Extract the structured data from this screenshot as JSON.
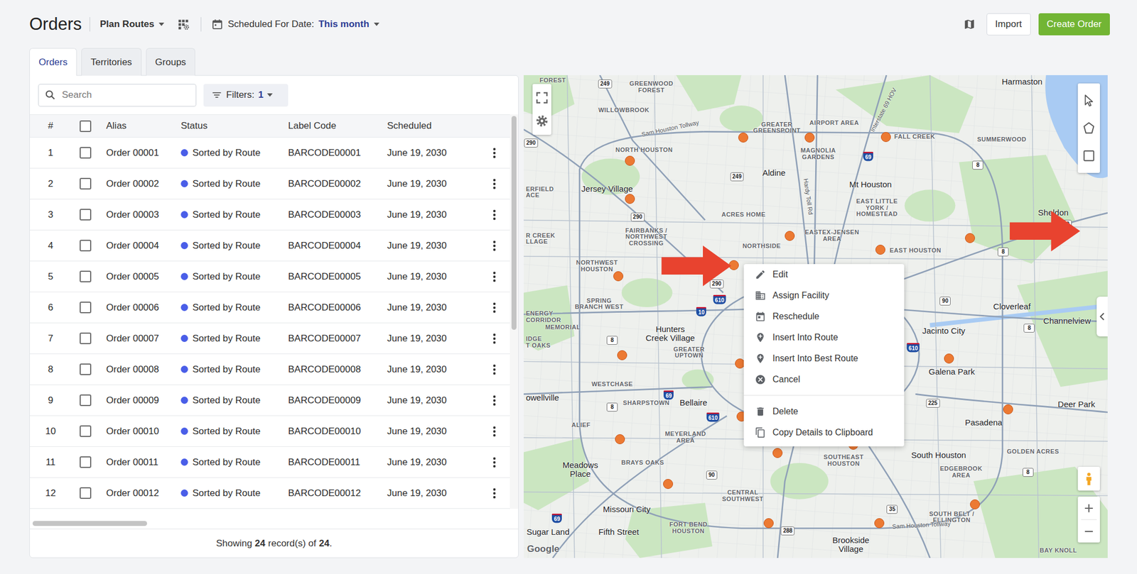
{
  "header": {
    "title": "Orders",
    "view_menu": "Plan Routes",
    "date_label": "Scheduled For Date:",
    "date_value": "This month",
    "import_button": "Import",
    "create_button": "Create Order"
  },
  "tabs": [
    {
      "label": "Orders",
      "selected": true
    },
    {
      "label": "Territories",
      "selected": false
    },
    {
      "label": "Groups",
      "selected": false
    }
  ],
  "search": {
    "placeholder": "Search"
  },
  "filters": {
    "label": "Filters:",
    "count": "1"
  },
  "table": {
    "columns": [
      "#",
      "Alias",
      "Status",
      "Label Code",
      "Scheduled"
    ],
    "select_all_checked": false,
    "rows": [
      {
        "number": "1",
        "checked": false,
        "alias": "Order 00001",
        "status": "Sorted by Route",
        "color": "#4a5ee8",
        "label_code": "BARCODE00001",
        "scheduled": "June 19, 2030"
      },
      {
        "number": "2",
        "checked": false,
        "alias": "Order 00002",
        "status": "Sorted by Route",
        "color": "#4a5ee8",
        "label_code": "BARCODE00002",
        "scheduled": "June 19, 2030"
      },
      {
        "number": "3",
        "checked": false,
        "alias": "Order 00003",
        "status": "Sorted by Route",
        "color": "#4a5ee8",
        "label_code": "BARCODE00003",
        "scheduled": "June 19, 2030"
      },
      {
        "number": "4",
        "checked": false,
        "alias": "Order 00004",
        "status": "Sorted by Route",
        "color": "#4a5ee8",
        "label_code": "BARCODE00004",
        "scheduled": "June 19, 2030"
      },
      {
        "number": "5",
        "checked": false,
        "alias": "Order 00005",
        "status": "Sorted by Route",
        "color": "#4a5ee8",
        "label_code": "BARCODE00005",
        "scheduled": "June 19, 2030"
      },
      {
        "number": "6",
        "checked": false,
        "alias": "Order 00006",
        "status": "Sorted by Route",
        "color": "#4a5ee8",
        "label_code": "BARCODE00006",
        "scheduled": "June 19, 2030"
      },
      {
        "number": "7",
        "checked": false,
        "alias": "Order 00007",
        "status": "Sorted by Route",
        "color": "#4a5ee8",
        "label_code": "BARCODE00007",
        "scheduled": "June 19, 2030"
      },
      {
        "number": "8",
        "checked": false,
        "alias": "Order 00008",
        "status": "Sorted by Route",
        "color": "#4a5ee8",
        "label_code": "BARCODE00008",
        "scheduled": "June 19, 2030"
      },
      {
        "number": "9",
        "checked": false,
        "alias": "Order 00009",
        "status": "Sorted by Route",
        "color": "#4a5ee8",
        "label_code": "BARCODE00009",
        "scheduled": "June 19, 2030"
      },
      {
        "number": "10",
        "checked": false,
        "alias": "Order 00010",
        "status": "Sorted by Route",
        "color": "#4a5ee8",
        "label_code": "BARCODE00010",
        "scheduled": "June 19, 2030"
      },
      {
        "number": "11",
        "checked": false,
        "alias": "Order 00011",
        "status": "Sorted by Route",
        "color": "#4a5ee8",
        "label_code": "BARCODE00011",
        "scheduled": "June 19, 2030"
      },
      {
        "number": "12",
        "checked": false,
        "alias": "Order 00012",
        "status": "Sorted by Route",
        "color": "#4a5ee8",
        "label_code": "BARCODE00012",
        "scheduled": "June 19, 2030"
      }
    ]
  },
  "footer": {
    "prefix": "Showing",
    "shown": "24",
    "middle": "record(s) of",
    "total": "24",
    "suffix": "."
  },
  "map": {
    "attribution": "Google",
    "labels": [
      {
        "lines": [
          "FOREST"
        ],
        "kind": "district"
      },
      {
        "lines": [
          "GREENWOOD",
          "FOREST"
        ],
        "kind": "district"
      },
      {
        "lines": [
          "WILLOWBROOK"
        ],
        "kind": "district"
      },
      {
        "lines": [
          "GREATER",
          "GREENSPOINT"
        ],
        "kind": "district"
      },
      {
        "lines": [
          "AIRPORT AREA"
        ],
        "kind": "district"
      },
      {
        "lines": [
          "FALL CREEK"
        ],
        "kind": "district"
      },
      {
        "lines": [
          "SUMMERWOOD"
        ],
        "kind": "district"
      },
      {
        "lines": [
          "Harmaston"
        ],
        "kind": "city"
      },
      {
        "lines": [
          "NORTH HOUSTON"
        ],
        "kind": "district"
      },
      {
        "lines": [
          "MAGNOLIA",
          "GARDENS"
        ],
        "kind": "district"
      },
      {
        "lines": [
          "Aldine"
        ],
        "kind": "city"
      },
      {
        "lines": [
          "Jersey Village"
        ],
        "kind": "city"
      },
      {
        "lines": [
          "Mt Houston"
        ],
        "kind": "city"
      },
      {
        "lines": [
          "EAST LITTLE",
          "YORK /",
          "HOMESTEAD"
        ],
        "kind": "district"
      },
      {
        "lines": [
          "Sheldon"
        ],
        "kind": "city"
      },
      {
        "lines": [
          "ACRES HOME"
        ],
        "kind": "district"
      },
      {
        "lines": [
          "FAIRBANKS /",
          "NORTHWEST",
          "CROSSING"
        ],
        "kind": "district"
      },
      {
        "lines": [
          "EASTEX-JENSEN",
          "AREA"
        ],
        "kind": "district"
      },
      {
        "lines": [
          "NORTHSIDE"
        ],
        "kind": "district"
      },
      {
        "lines": [
          "EAST HOUSTON"
        ],
        "kind": "district"
      },
      {
        "lines": [
          "NORTHWEST",
          "HOUSTON"
        ],
        "kind": "district"
      },
      {
        "lines": [
          "SPRING",
          "BRANCH WEST"
        ],
        "kind": "district"
      },
      {
        "lines": [
          "Cloverleaf"
        ],
        "kind": "city"
      },
      {
        "lines": [
          "Channelview"
        ],
        "kind": "city"
      },
      {
        "lines": [
          "ENERGY",
          "CORRIDOR"
        ],
        "kind": "district"
      },
      {
        "lines": [
          "MEMORIAL"
        ],
        "kind": "district"
      },
      {
        "lines": [
          "Hunters",
          "Creek Village"
        ],
        "kind": "city"
      },
      {
        "lines": [
          "GREATER",
          "UPTOWN"
        ],
        "kind": "district"
      },
      {
        "lines": [
          "Jacinto City"
        ],
        "kind": "city"
      },
      {
        "lines": [
          "Galena Park"
        ],
        "kind": "city"
      },
      {
        "lines": [
          "WESTCHASE"
        ],
        "kind": "district"
      },
      {
        "lines": [
          "SHARPSTOWN"
        ],
        "kind": "district"
      },
      {
        "lines": [
          "Bellaire"
        ],
        "kind": "city"
      },
      {
        "lines": [
          "Deer Park"
        ],
        "kind": "city"
      },
      {
        "lines": [
          "Pasadena"
        ],
        "kind": "city"
      },
      {
        "lines": [
          "ALIEF"
        ],
        "kind": "district"
      },
      {
        "lines": [
          "MEYERLAND",
          "AREA"
        ],
        "kind": "district"
      },
      {
        "lines": [
          "SOUTHEAST",
          "HOUSTON"
        ],
        "kind": "district"
      },
      {
        "lines": [
          "South Houston"
        ],
        "kind": "city"
      },
      {
        "lines": [
          "GOLDEN ACRES"
        ],
        "kind": "district"
      },
      {
        "lines": [
          "BRAYS OAKS"
        ],
        "kind": "district"
      },
      {
        "lines": [
          "Meadows",
          "Place"
        ],
        "kind": "city"
      },
      {
        "lines": [
          "EDGEBROOK",
          "AREA"
        ],
        "kind": "district"
      },
      {
        "lines": [
          "CENTRAL",
          "SOUTHWEST"
        ],
        "kind": "district"
      },
      {
        "lines": [
          "Missouri City"
        ],
        "kind": "city"
      },
      {
        "lines": [
          "SOUTH BELT /",
          "ELLINGTON"
        ],
        "kind": "district"
      },
      {
        "lines": [
          "FORT BEND",
          "HOUSTON"
        ],
        "kind": "district"
      },
      {
        "lines": [
          "Sugar Land"
        ],
        "kind": "city"
      },
      {
        "lines": [
          "Fifth Street"
        ],
        "kind": "city"
      },
      {
        "lines": [
          "Brookside",
          "Village"
        ],
        "kind": "city"
      },
      {
        "lines": [
          "BAY KNOLL"
        ],
        "kind": "district"
      },
      {
        "lines": [
          "ERFIELD",
          "ACE"
        ],
        "kind": "district"
      },
      {
        "lines": [
          "R CREEK",
          "LLAGE"
        ],
        "kind": "district"
      },
      {
        "lines": [
          "IDGE",
          "T OAKS"
        ],
        "kind": "district"
      },
      {
        "lines": [
          "owellville"
        ],
        "kind": "city"
      },
      {
        "lines": [
          "Sam Houston Tollway"
        ],
        "kind": "road"
      },
      {
        "lines": [
          "Interstate 69 HOV"
        ],
        "kind": "road"
      },
      {
        "lines": [
          "Hardy Toll Rd"
        ],
        "kind": "road"
      },
      {
        "lines": [
          "Sam Houston Tollway"
        ],
        "kind": "road"
      }
    ],
    "shields": [
      {
        "text": "249",
        "kind": "route"
      },
      {
        "text": "290",
        "kind": "route"
      },
      {
        "text": "249",
        "kind": "route"
      },
      {
        "text": "290",
        "kind": "route"
      },
      {
        "text": "69",
        "kind": "interstate"
      },
      {
        "text": "8",
        "kind": "route"
      },
      {
        "text": "90",
        "kind": "route"
      },
      {
        "text": "8",
        "kind": "route"
      },
      {
        "text": "290",
        "kind": "route"
      },
      {
        "text": "610",
        "kind": "interstate"
      },
      {
        "text": "10",
        "kind": "interstate"
      },
      {
        "text": "90",
        "kind": "route"
      },
      {
        "text": "8",
        "kind": "route"
      },
      {
        "text": "610",
        "kind": "interstate"
      },
      {
        "text": "8",
        "kind": "route"
      },
      {
        "text": "69",
        "kind": "interstate"
      },
      {
        "text": "8",
        "kind": "route"
      },
      {
        "text": "610",
        "kind": "interstate"
      },
      {
        "text": "225",
        "kind": "route"
      },
      {
        "text": "90",
        "kind": "route"
      },
      {
        "text": "69",
        "kind": "interstate"
      },
      {
        "text": "35",
        "kind": "route"
      },
      {
        "text": "288",
        "kind": "route"
      },
      {
        "text": "8",
        "kind": "route"
      }
    ],
    "context_menu": {
      "groups": [
        [
          "Edit",
          "Assign Facility",
          "Reschedule",
          "Insert Into Route",
          "Insert Into Best Route",
          "Cancel"
        ],
        [
          "Delete",
          "Copy Details to Clipboard"
        ]
      ]
    }
  }
}
